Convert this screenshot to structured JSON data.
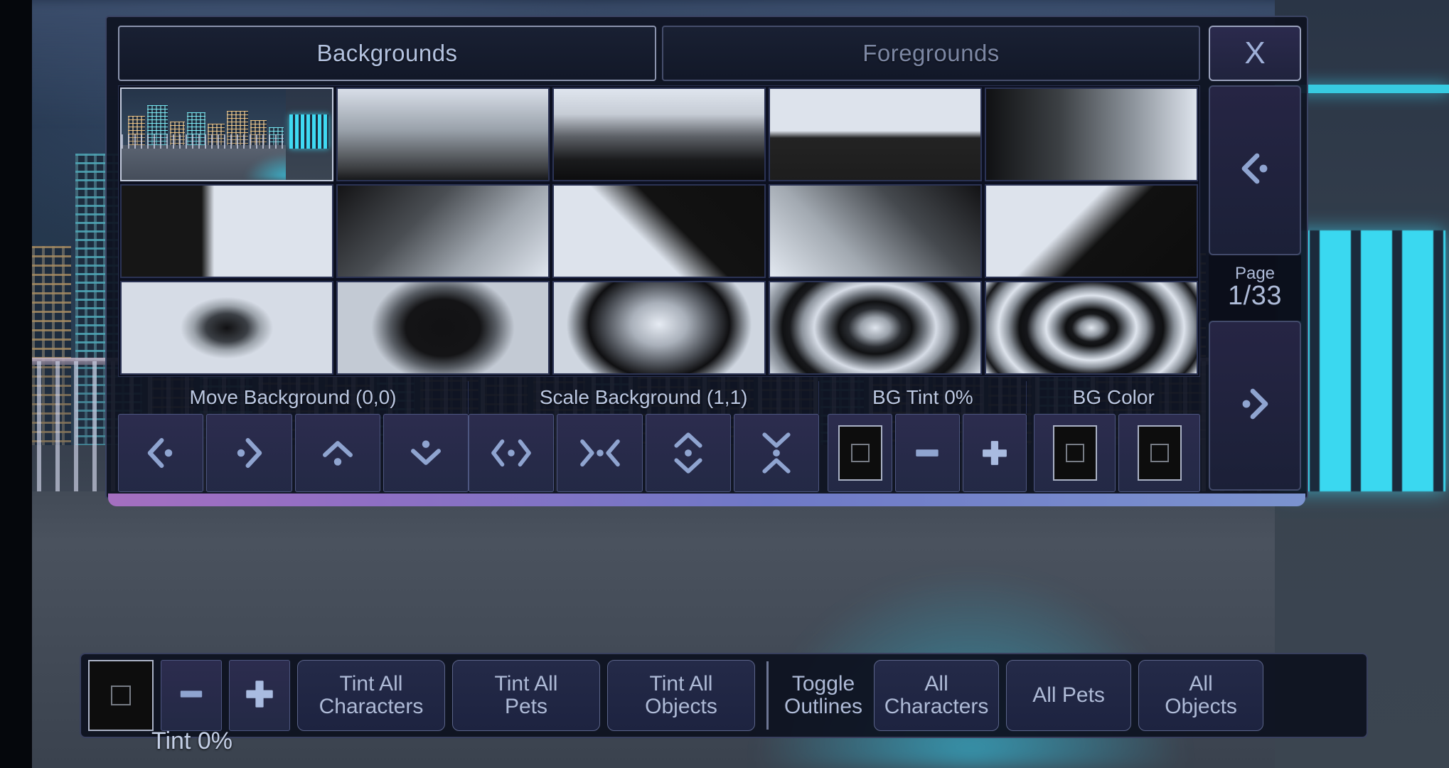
{
  "panel": {
    "tabs": [
      {
        "label": "Backgrounds",
        "active": true
      },
      {
        "label": "Foregrounds",
        "active": false
      }
    ],
    "sidebar": {
      "close_label": "X",
      "prev_icon": "chevron-left-dot-icon",
      "next_icon": "dot-chevron-right-icon",
      "page_label": "Page",
      "page_value": "1/33"
    },
    "grid": {
      "thumbnails": [
        {
          "name": "city-rooftop-night",
          "kind": "scene",
          "selected": true
        },
        {
          "name": "gradient-vertical-soft",
          "kind": "linear",
          "css": "linear-gradient(180deg,#d8dee8 0%,#9aa2ab 45%,#3a3c3f 88%,#17181a 100%)",
          "selected": false
        },
        {
          "name": "gradient-vertical-sharp",
          "kind": "linear",
          "css": "linear-gradient(180deg,#dfe5ee 0%,#c6ccd5 28%,#5e6268 52%,#1a1b1d 78%,#0d0d0e 100%)",
          "selected": false
        },
        {
          "name": "split-horizontal-hard",
          "kind": "linear",
          "css": "linear-gradient(180deg,#dde3ec 0%,#dde3ec 46%,#232323 54%,#1d1d1d 100%)",
          "selected": false
        },
        {
          "name": "gradient-horizontal",
          "kind": "linear",
          "css": "linear-gradient(90deg,#101113 0%,#3c4044 35%,#8d949c 70%,#dde3ec 100%)",
          "selected": false
        },
        {
          "name": "split-vertical-hard",
          "kind": "linear",
          "css": "linear-gradient(90deg,#161616 0%,#161616 38%,#dde3ec 44%,#dde3ec 100%)",
          "selected": false
        },
        {
          "name": "gradient-diagonal",
          "kind": "linear",
          "css": "linear-gradient(135deg,#141416 0%,#4a4e53 38%,#9fa6ae 68%,#dfe5ee 100%)",
          "selected": false
        },
        {
          "name": "split-diagonal-up",
          "kind": "linear",
          "css": "linear-gradient(45deg,#dde3ec 0%,#dde3ec 42%,#121212 58%,#0f0f0f 100%)",
          "selected": false
        },
        {
          "name": "gradient-diagonal-reverse",
          "kind": "linear",
          "css": "linear-gradient(225deg,#131315 0%,#45494e 34%,#a2a9b1 66%,#e2e8f0 100%)",
          "selected": false
        },
        {
          "name": "split-diagonal-down",
          "kind": "linear",
          "css": "linear-gradient(135deg,#dde3ec 0%,#dde3ec 40%,#111111 56%,#0d0d0d 100%)",
          "selected": false
        },
        {
          "name": "radial-dark-center-small",
          "kind": "radial",
          "css": "radial-gradient(ellipse 22% 34% at 50% 50%,#111113 0%,#3b3f45 45%,#9ba2aa 72%,#d6dce6 100%)",
          "selected": false
        },
        {
          "name": "radial-dark-center-large",
          "kind": "radial",
          "css": "radial-gradient(ellipse 34% 60% at 50% 50%,#121214 0%,#141416 52%,#575c63 74%,#c3cad4 100%)",
          "selected": false
        },
        {
          "name": "radial-light-center-ring",
          "kind": "radial",
          "css": "radial-gradient(ellipse 44% 78% at 50% 46%,#e6ebf3 0%,#a9b0ba 30%,#4a4e55 58%,#0f0f11 76%,#9fa6af 94%,#cfd6e0 100%)",
          "selected": false
        },
        {
          "name": "rings-two",
          "kind": "rings",
          "css": "radial-gradient(ellipse 58% 96% at 50% 50%,#dfe5ee 0%,#9aa1aa 12%,#2a2d32 22%,#101113 30%,#6b7179 40%,#d6dce6 50%,#8d949d 60%,#18191c 70%,#101113 76%,#7b828b 86%,#cdd4de 100%)",
          "selected": false
        },
        {
          "name": "rings-three",
          "kind": "rings",
          "css": "radial-gradient(ellipse 58% 96% at 50% 50%,#e2e8f0 0%,#8f969f 9%,#17181b 16%,#0f1012 21%,#868d96 30%,#dfe5ee 37%,#8d949d 45%,#15161a 53%,#0f1012 59%,#8a919a 68%,#dde3ec 76%,#8b929b 84%,#16171a 92%,#cfd6e0 100%)",
          "selected": false
        }
      ]
    },
    "controls": {
      "move_label": "Move Background (0,0)",
      "scale_label": "Scale Background (1,1)",
      "tint_label": "BG Tint 0%",
      "color_label": "BG Color",
      "move_buttons": [
        {
          "name": "move-left-button",
          "icon": "chevron-left-dot-icon"
        },
        {
          "name": "move-right-button",
          "icon": "dot-chevron-right-icon"
        },
        {
          "name": "move-up-button",
          "icon": "chevron-up-dot-icon"
        },
        {
          "name": "move-down-button",
          "icon": "dot-chevron-down-icon"
        }
      ],
      "scale_buttons": [
        {
          "name": "scale-width-increase-button",
          "icon": "expand-horizontal-icon"
        },
        {
          "name": "scale-width-decrease-button",
          "icon": "contract-horizontal-icon"
        },
        {
          "name": "scale-height-increase-button",
          "icon": "expand-vertical-icon"
        },
        {
          "name": "scale-height-decrease-button",
          "icon": "contract-vertical-icon"
        }
      ],
      "tint_swatch": {
        "name": "bg-tint-swatch",
        "color": "#0d0d0d"
      },
      "tint_minus": "minus-icon",
      "tint_plus": "plus-icon",
      "color_swatches": [
        {
          "name": "bg-color-swatch-1",
          "color": "#0d0d0d"
        },
        {
          "name": "bg-color-swatch-2",
          "color": "#0d0d0d"
        }
      ]
    }
  },
  "bottom_bar": {
    "tint_swatch_color": "#0d0d0d",
    "minus_icon": "minus-icon",
    "plus_icon": "plus-icon",
    "tint_label": "Tint 0%",
    "buttons": [
      {
        "name": "tint-all-characters-button",
        "line1": "Tint All",
        "line2": "Characters"
      },
      {
        "name": "tint-all-pets-button",
        "line1": "Tint All",
        "line2": "Pets"
      },
      {
        "name": "tint-all-objects-button",
        "line1": "Tint All",
        "line2": "Objects"
      }
    ],
    "toggle_outlines": {
      "line1": "Toggle",
      "line2": "Outlines"
    },
    "outline_buttons": [
      {
        "name": "all-characters-button",
        "line1": "All",
        "line2": "Characters"
      },
      {
        "name": "all-pets-button",
        "line1": "All Pets",
        "line2": ""
      },
      {
        "name": "all-objects-button",
        "line1": "All",
        "line2": "Objects"
      }
    ]
  },
  "theme": {
    "accent_purple": "#a46fc0",
    "accent_blue": "#7b93cf",
    "text_primary": "#b3c2df",
    "panel_bg": "#0e1221"
  }
}
